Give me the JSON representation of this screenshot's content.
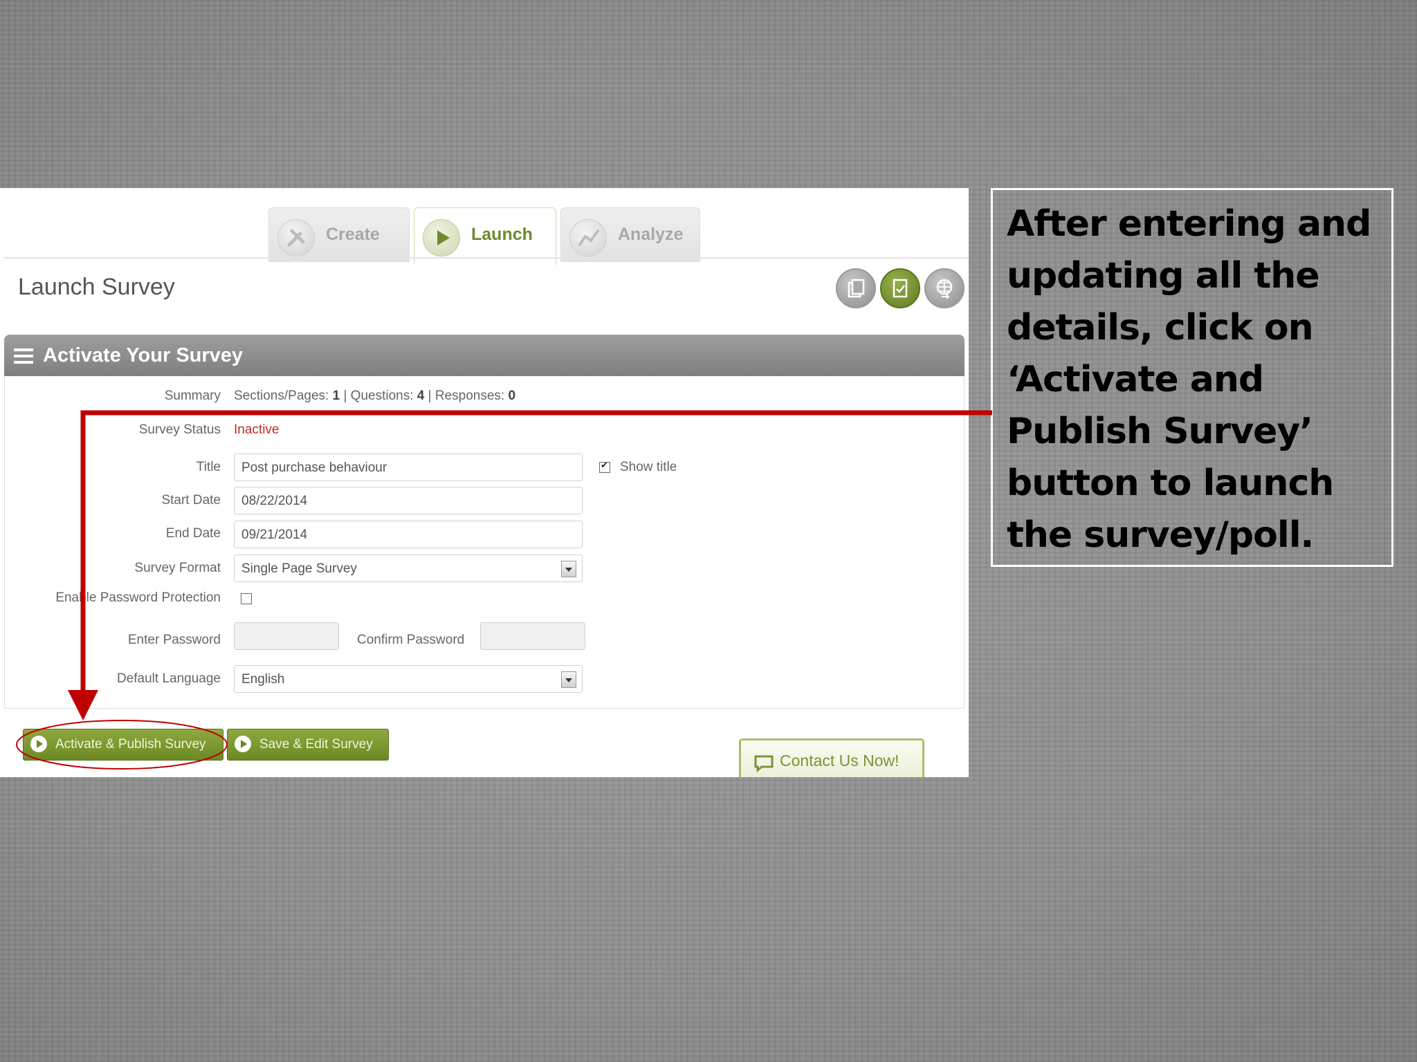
{
  "tabs": [
    {
      "label": "Create",
      "state": "inactive",
      "icon": "tools-icon"
    },
    {
      "label": "Launch",
      "state": "active",
      "icon": "play-icon"
    },
    {
      "label": "Analyze",
      "state": "inactive",
      "icon": "chart-icon"
    }
  ],
  "page_title": "Launch Survey",
  "section_title": "Activate Your Survey",
  "form": {
    "summary_label": "Summary",
    "summary_sections_label": "Sections/Pages:",
    "summary_sections": "1",
    "summary_questions_label": "| Questions:",
    "summary_questions": "4",
    "summary_responses_label": "| Responses:",
    "summary_responses": "0",
    "status_label": "Survey Status",
    "status_value": "Inactive",
    "title_label": "Title",
    "title_value": "Post purchase behaviour",
    "show_title_label": "Show title",
    "show_title_checked": true,
    "start_label": "Start Date",
    "start_value": "08/22/2014",
    "end_label": "End Date",
    "end_value": "09/21/2014",
    "format_label": "Survey Format",
    "format_value": "Single Page Survey",
    "password_label": "Enable Password Protection",
    "password_checked": false,
    "enter_password_label": "Enter Password",
    "confirm_password_label": "Confirm Password",
    "language_label": "Default Language",
    "language_value": "English"
  },
  "buttons": {
    "activate": "Activate & Publish Survey",
    "save_edit": "Save & Edit Survey",
    "contact": "Contact Us Now!"
  },
  "callout": "After entering and updating all the details, click on ‘Activate and Publish Survey’ button to launch the survey/poll.",
  "colors": {
    "accent_green": "#6b8a24",
    "arrow_red": "#c00000",
    "status_red": "#c62828"
  }
}
